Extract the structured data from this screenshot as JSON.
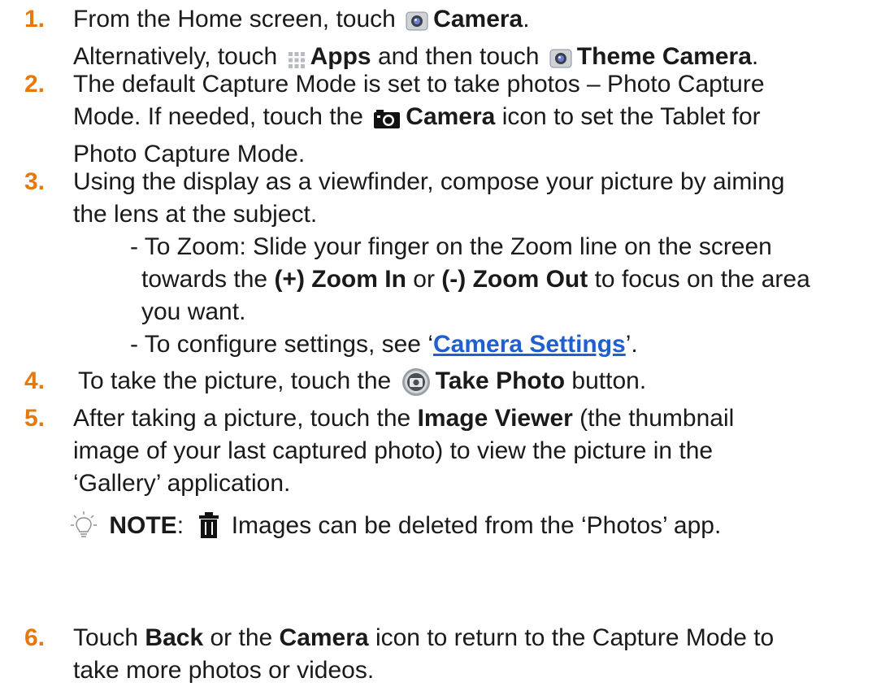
{
  "steps": [
    {
      "number": "1.",
      "line1": {
        "pre": "From the Home screen, touch",
        "b1": "Camera",
        "post": "."
      },
      "line2": {
        "pre": "Alternatively, touch",
        "b1": "Apps",
        "mid": "and then touch",
        "b2": "Theme Camera",
        "post": "."
      }
    },
    {
      "number": "2.",
      "line1": "The default Capture Mode is set to take photos – Photo Capture",
      "line2": {
        "pre": "Mode. If needed, touch the",
        "b1": "Camera",
        "post": "icon to set the Tablet for"
      },
      "line3": "Photo Capture Mode."
    },
    {
      "number": "3.",
      "line1": "Using the display as a viewfinder, compose your picture by aiming",
      "line2": "the lens at the subject.",
      "zoom": {
        "l1": "- To Zoom: Slide your finger on the Zoom line on the screen",
        "l2_pre": "towards the",
        "l2_b1": "(+) Zoom In",
        "l2_mid": "or",
        "l2_b2": "(-) Zoom Out",
        "l2_post": "to focus on the area",
        "l3": "you want."
      },
      "settings": {
        "pre": "- To configure settings, see ‘",
        "link": "Camera Settings",
        "post": "’."
      }
    },
    {
      "number": "4.",
      "line1": {
        "pre": "To take the picture, touch the",
        "b1": "Take Photo",
        "post": "button."
      }
    },
    {
      "number": "5.",
      "line1": {
        "pre": "After taking a picture, touch the",
        "b1": "Image Viewer",
        "post": "(the thumbnail"
      },
      "line2": "image of your last captured photo) to view the picture in the",
      "line3": "‘Gallery’ application.",
      "note": {
        "label": "NOTE",
        "colon": ":",
        "text": "Images can be deleted from the ‘Photos’ app."
      }
    },
    {
      "number": "6.",
      "line1": {
        "pre": "Touch",
        "b1": "Back",
        "mid": "or the",
        "b2": "Camera",
        "post": "icon to return to the Capture Mode to"
      },
      "line2": "take more photos or videos."
    }
  ],
  "colors": {
    "number": "#e8780a",
    "link": "#1f5fd0",
    "text": "#1a1a1a"
  },
  "icons": [
    "camera-app-icon",
    "apps-grid-icon",
    "theme-camera-icon",
    "camera-mode-icon",
    "take-photo-icon",
    "lightbulb-icon",
    "trash-icon"
  ]
}
